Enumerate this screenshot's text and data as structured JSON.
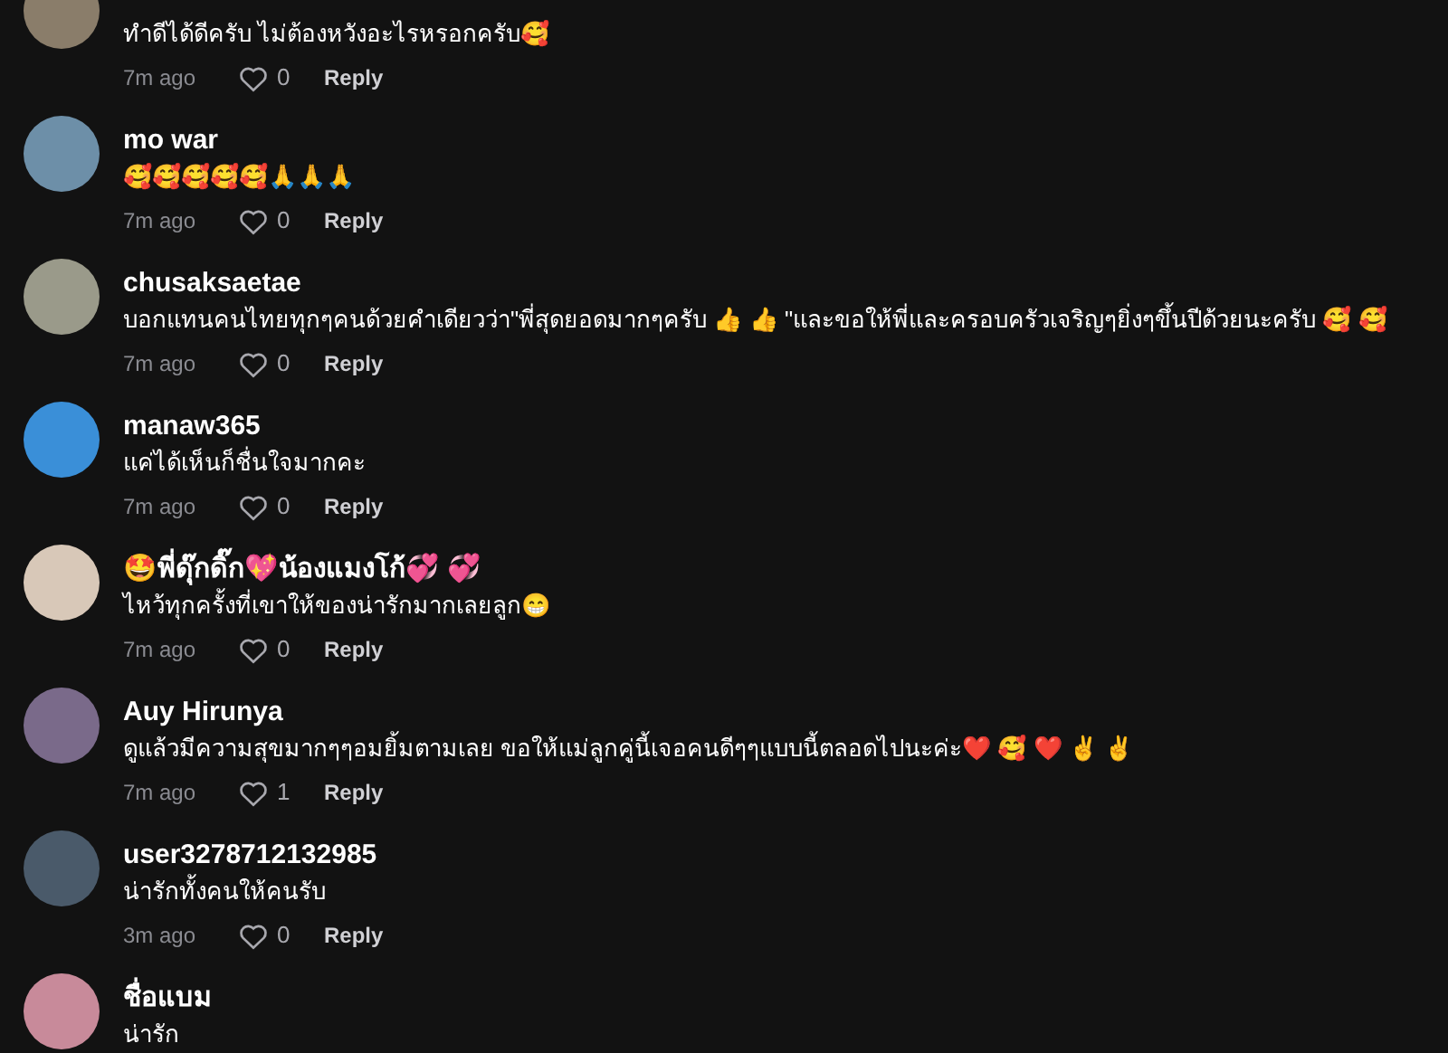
{
  "comments": [
    {
      "text": "ทำดีได้ดีครับ ไม่ต้องหวังอะไรหรอกครับ🥰",
      "time": "7m ago",
      "likes": "0",
      "reply": "Reply"
    },
    {
      "user": "mo war",
      "text": "🥰🥰🥰🥰🥰🙏🙏🙏",
      "time": "7m ago",
      "likes": "0",
      "reply": "Reply"
    },
    {
      "user": "chusaksaetae",
      "text": "บอกแทนคนไทยทุกๆคนด้วยคำเดียวว่า\"พี่สุดยอดมากๆครับ 👍 👍 \"และขอให้พี่และครอบครัวเจริญๆยิ่งๆขึ้นปีด้วยนะครับ 🥰 🥰",
      "time": "7m ago",
      "likes": "0",
      "reply": "Reply"
    },
    {
      "user": "manaw365",
      "text": "แค่ได้เห็นก็ชื่นใจมากคะ",
      "time": "7m ago",
      "likes": "0",
      "reply": "Reply"
    },
    {
      "user": "🤩พี่ดุ๊กดิ๊ก💖น้องแมงโก้💞 💞",
      "text": "ไหว้ทุกครั้งที่เขาให้ของน่ารักมากเลยลูก😁",
      "time": "7m ago",
      "likes": "0",
      "reply": "Reply"
    },
    {
      "user": "Auy Hirunya",
      "text": "ดูแล้วมีความสุขมากๆๆอมยิ้มตามเลย ขอให้แม่ลูกคู่นี้เจอคนดีๆๆแบบนี้ตลอดไปนะค่ะ❤️ 🥰 ❤️ ✌️ ✌️",
      "time": "7m ago",
      "likes": "1",
      "reply": "Reply"
    },
    {
      "user": "user3278712132985",
      "text": "น่ารักทั้งคนให้คนรับ",
      "time": "3m ago",
      "likes": "0",
      "reply": "Reply"
    },
    {
      "user": "ชื่อแบม",
      "text": "น่ารัก"
    }
  ]
}
